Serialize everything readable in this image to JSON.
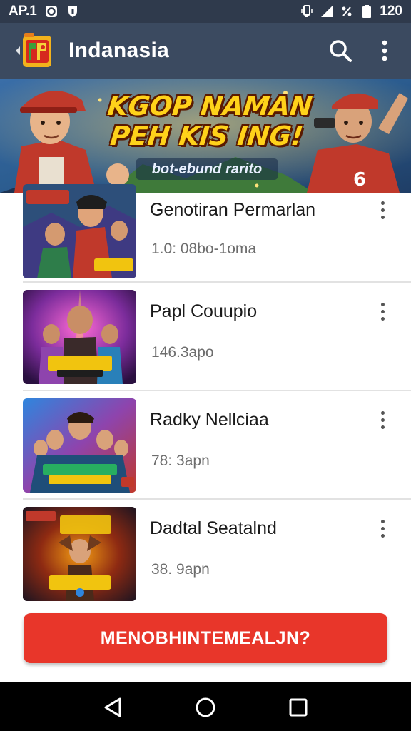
{
  "status_bar": {
    "carrier": "AP.1",
    "time": "120",
    "icons": [
      "notification-icon",
      "shield-icon",
      "vibrate-icon",
      "signal-icon",
      "battery-icon"
    ]
  },
  "app_bar": {
    "title": "Indanasia",
    "background": "#3b4a60",
    "actions": [
      "search-icon",
      "more-vert-icon"
    ]
  },
  "banner": {
    "title": "KGOP NAMAN PEH KIS ING!",
    "subtitle": "bot-ebund rarito"
  },
  "list": {
    "items": [
      {
        "title": "Genotiran Permarlan",
        "meta": "1.0: 08bo-1oma",
        "thumb_caption": "NOIKAM ONEIS",
        "thumb_top": "MOSEISAK"
      },
      {
        "title": "Papl Couupio",
        "meta": "146.3apo",
        "thumb_caption": "NOIKAM",
        "thumb_top": "ONEIS"
      },
      {
        "title": "Radky Nellciaa",
        "meta": "78: 3apn",
        "thumb_caption": "HERENER",
        "thumb_top": "NOSSHOOM"
      },
      {
        "title": "Dadtal Seatalnd",
        "meta": "38. 9apn",
        "thumb_caption": "Sareaar",
        "thumb_top": "NOAN NANEIK"
      }
    ]
  },
  "cta": {
    "label": "MENOBHINTEMEALJN?",
    "color": "#e8362a"
  },
  "nav": {
    "buttons": [
      "back-icon",
      "home-icon",
      "recents-icon"
    ]
  }
}
